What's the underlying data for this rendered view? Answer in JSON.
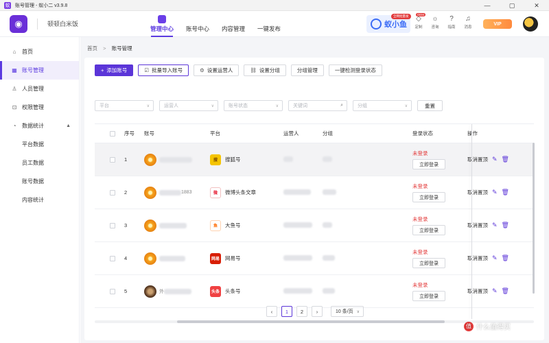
{
  "window": {
    "title": "账号管理 - 蚁小二 v3.9.8",
    "controls": [
      "—",
      "▢",
      "✕"
    ]
  },
  "header": {
    "brand_name": "顿顿白米饭",
    "nav": [
      {
        "label": "管理中心",
        "active": true
      },
      {
        "label": "账号中心",
        "active": false
      },
      {
        "label": "内容管理",
        "active": false
      },
      {
        "label": "一键发布",
        "active": false
      }
    ],
    "promo": {
      "text": "蚁小鱼",
      "badge": "全网批量发"
    },
    "icons": [
      {
        "name": "custom-icon",
        "label": "定制",
        "badge": "OEM"
      },
      {
        "name": "bulb-icon",
        "label": "咨询"
      },
      {
        "name": "help-icon",
        "label": "指南"
      },
      {
        "name": "bell-icon",
        "label": "消息"
      }
    ],
    "vip_label": "VIP"
  },
  "sidebar": {
    "items": [
      {
        "label": "首页",
        "icon": "home-icon",
        "glyph": "⌂",
        "active": false
      },
      {
        "label": "账号管理",
        "icon": "grid-icon",
        "glyph": "▦",
        "active": true
      },
      {
        "label": "人员管理",
        "icon": "user-icon",
        "glyph": "♙",
        "active": false
      },
      {
        "label": "权限管理",
        "icon": "lock-icon",
        "glyph": "⊡",
        "active": false
      },
      {
        "label": "数据统计",
        "icon": "chart-icon",
        "glyph": "◔",
        "active": false,
        "expanded": true
      }
    ],
    "sub_items": [
      "平台数据",
      "员工数据",
      "账号数据",
      "内容统计"
    ]
  },
  "breadcrumb": {
    "home": "首页",
    "current": "账号管理"
  },
  "toolbar": {
    "add_account": "添加账号",
    "batch_import": "批量导入账号",
    "set_operator": "设置运营人",
    "set_group": "设置分组",
    "group_manage": "分组管理",
    "check_login": "一键检测登录状态"
  },
  "filters": {
    "platform": "平台",
    "operator": "运营人",
    "status": "账号状态",
    "keyword": "关键词",
    "group": "分组",
    "reset": "重置"
  },
  "table": {
    "columns": [
      "序号",
      "账号",
      "平台",
      "运营人",
      "分组",
      "登录状态",
      "操作"
    ],
    "rows": [
      {
        "no": "1",
        "account_suffix": "",
        "platform": "搜狐号",
        "platform_icon": "搜",
        "platform_color": "#f5c400",
        "status": "未登录",
        "login": "立即登录",
        "unpin": "取消置顶",
        "avatar": "orange"
      },
      {
        "no": "2",
        "account_suffix": "1883",
        "platform": "微博头条文章",
        "platform_icon": "微",
        "platform_color": "#e6162d",
        "status": "未登录",
        "login": "立即登录",
        "unpin": "取消置顶",
        "avatar": "orange"
      },
      {
        "no": "3",
        "account_suffix": "",
        "platform": "大鱼号",
        "platform_icon": "鱼",
        "platform_color": "#ff6a00",
        "status": "未登录",
        "login": "立即登录",
        "unpin": "取消置顶",
        "avatar": "orange"
      },
      {
        "no": "4",
        "account_suffix": "",
        "platform": "网易号",
        "platform_icon": "网易",
        "platform_color": "#d81e06",
        "status": "未登录",
        "login": "立即登录",
        "unpin": "取消置顶",
        "avatar": "orange"
      },
      {
        "no": "5",
        "account_suffix": "",
        "account_prefix": "外",
        "platform": "头条号",
        "platform_icon": "头条",
        "platform_color": "#f04142",
        "status": "未登录",
        "login": "立即登录",
        "unpin": "取消置顶",
        "avatar": "dark"
      }
    ]
  },
  "pagination": {
    "pages": [
      "1",
      "2"
    ],
    "current": "1",
    "page_size": "10 条/页"
  },
  "watermark": "什么值得买",
  "colors": {
    "primary": "#5b35d8",
    "danger": "#e33b3b",
    "bg": "#f4f5f8"
  }
}
